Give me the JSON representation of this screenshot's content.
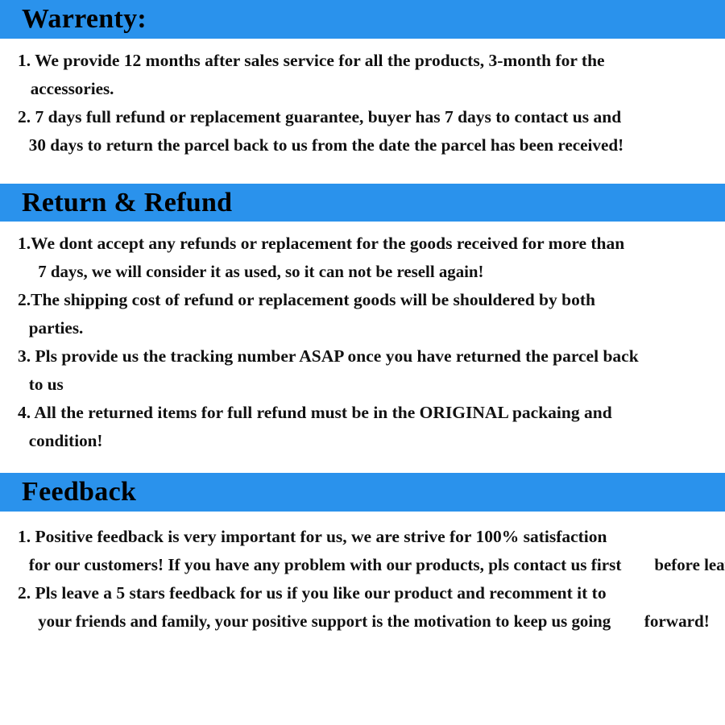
{
  "theme": {
    "band_color": "#2a92ec",
    "page_background": "#ffffff",
    "text_color": "#000000"
  },
  "sections": [
    {
      "id": "warranty",
      "title": "Warrenty:",
      "items": [
        {
          "number": "1.",
          "lines": [
            "1. We provide 12 months after sales service for all the products, 3-month for the",
            "accessories."
          ]
        },
        {
          "number": "2.",
          "lines": [
            "2. 7 days full refund or replacement guarantee, buyer has 7 days to contact us and",
            "30 days to return the parcel back to us from the date the parcel has been received!"
          ]
        }
      ]
    },
    {
      "id": "return-refund",
      "title": "Return & Refund",
      "items": [
        {
          "number": "1.",
          "lines": [
            "1.We dont accept any refunds or replacement for the goods received for more than",
            "7 days, we will consider it as used, so it can not be resell again!"
          ]
        },
        {
          "number": "2.",
          "lines": [
            "2.The shipping cost of refund or replacement goods will be shouldered by both",
            "parties."
          ]
        },
        {
          "number": "3.",
          "lines": [
            "3. Pls provide us the tracking number ASAP once you have returned the parcel back",
            "to us"
          ]
        },
        {
          "number": "4.",
          "lines": [
            "4. All the returned items for full refund must be in the ORIGINAL packaing and",
            "condition!"
          ]
        }
      ]
    },
    {
      "id": "feedback",
      "title": "Feedback",
      "items": [
        {
          "number": "1.",
          "lines": [
            "1. Positive feedback is very important for us, we are strive for 100% satisfaction",
            "for our customers! If you have any problem with our products, pls contact us first",
            "before leaving any Neutral or Negative feedbacks, we will try our best to help!"
          ]
        },
        {
          "number": "2.",
          "lines": [
            "2. Pls leave a 5 stars feedback for us if you like our product and recomment it to",
            "your friends and family, your positive support is the motivation to keep us going",
            "forward!"
          ]
        }
      ]
    }
  ]
}
